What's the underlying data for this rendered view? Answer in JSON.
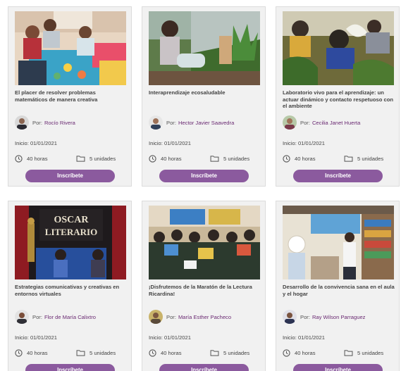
{
  "courses": [
    {
      "title": "El placer de resolver problemas matemáticos de manera creativa",
      "author_prefix": "Por:",
      "author": "Rocío Rivera",
      "start": "Inicio: 01/01/2021",
      "hours": "40 horas",
      "units": "5 unidades",
      "button": "Inscríbete"
    },
    {
      "title": "Interaprendizaje ecosaludable",
      "author_prefix": "Por:",
      "author": "Hector Javier Saavedra",
      "start": "Inicio: 01/01/2021",
      "hours": "40 horas",
      "units": "5 unidades",
      "button": "Inscríbete"
    },
    {
      "title": "Laboratorio vivo para el aprendizaje: un actuar dinámico y contacto respetuoso con el ambiente",
      "author_prefix": "Por:",
      "author": "Cecilia Janet Huerta",
      "start": "Inicio: 01/01/2021",
      "hours": "40 horas",
      "units": "5 unidades",
      "button": "Inscríbete"
    },
    {
      "title": "Estrategias comunicativas y creativas en entornos virtuales",
      "author_prefix": "Por:",
      "author": "Flor de María Calixtro",
      "start": "Inicio: 01/01/2021",
      "hours": "40 horas",
      "units": "5 unidades",
      "button": "Inscríbete",
      "image_text": [
        "OSCAR",
        "LITERARIO"
      ]
    },
    {
      "title": "¡Disfrutemos de la Maratón de la Lectura Ricardina!",
      "author_prefix": "Por:",
      "author": "María Esther Pacheco",
      "start": "Inicio: 01/01/2021",
      "hours": "40 horas",
      "units": "5 unidades",
      "button": "Inscríbete"
    },
    {
      "title": "Desarrollo de la convivencia sana en el aula y el hogar",
      "author_prefix": "Por:",
      "author": "Ray Wilson Parraguez",
      "start": "Inicio: 01/01/2021",
      "hours": "40 horas",
      "units": "5 unidades",
      "button": "Inscríbete"
    }
  ],
  "icons": {
    "hours": "clock-icon",
    "units": "folder-icon"
  },
  "colors": {
    "button": "#8b5a9e",
    "author_link": "#6a2a72",
    "card_bg": "#f1f1f1"
  }
}
